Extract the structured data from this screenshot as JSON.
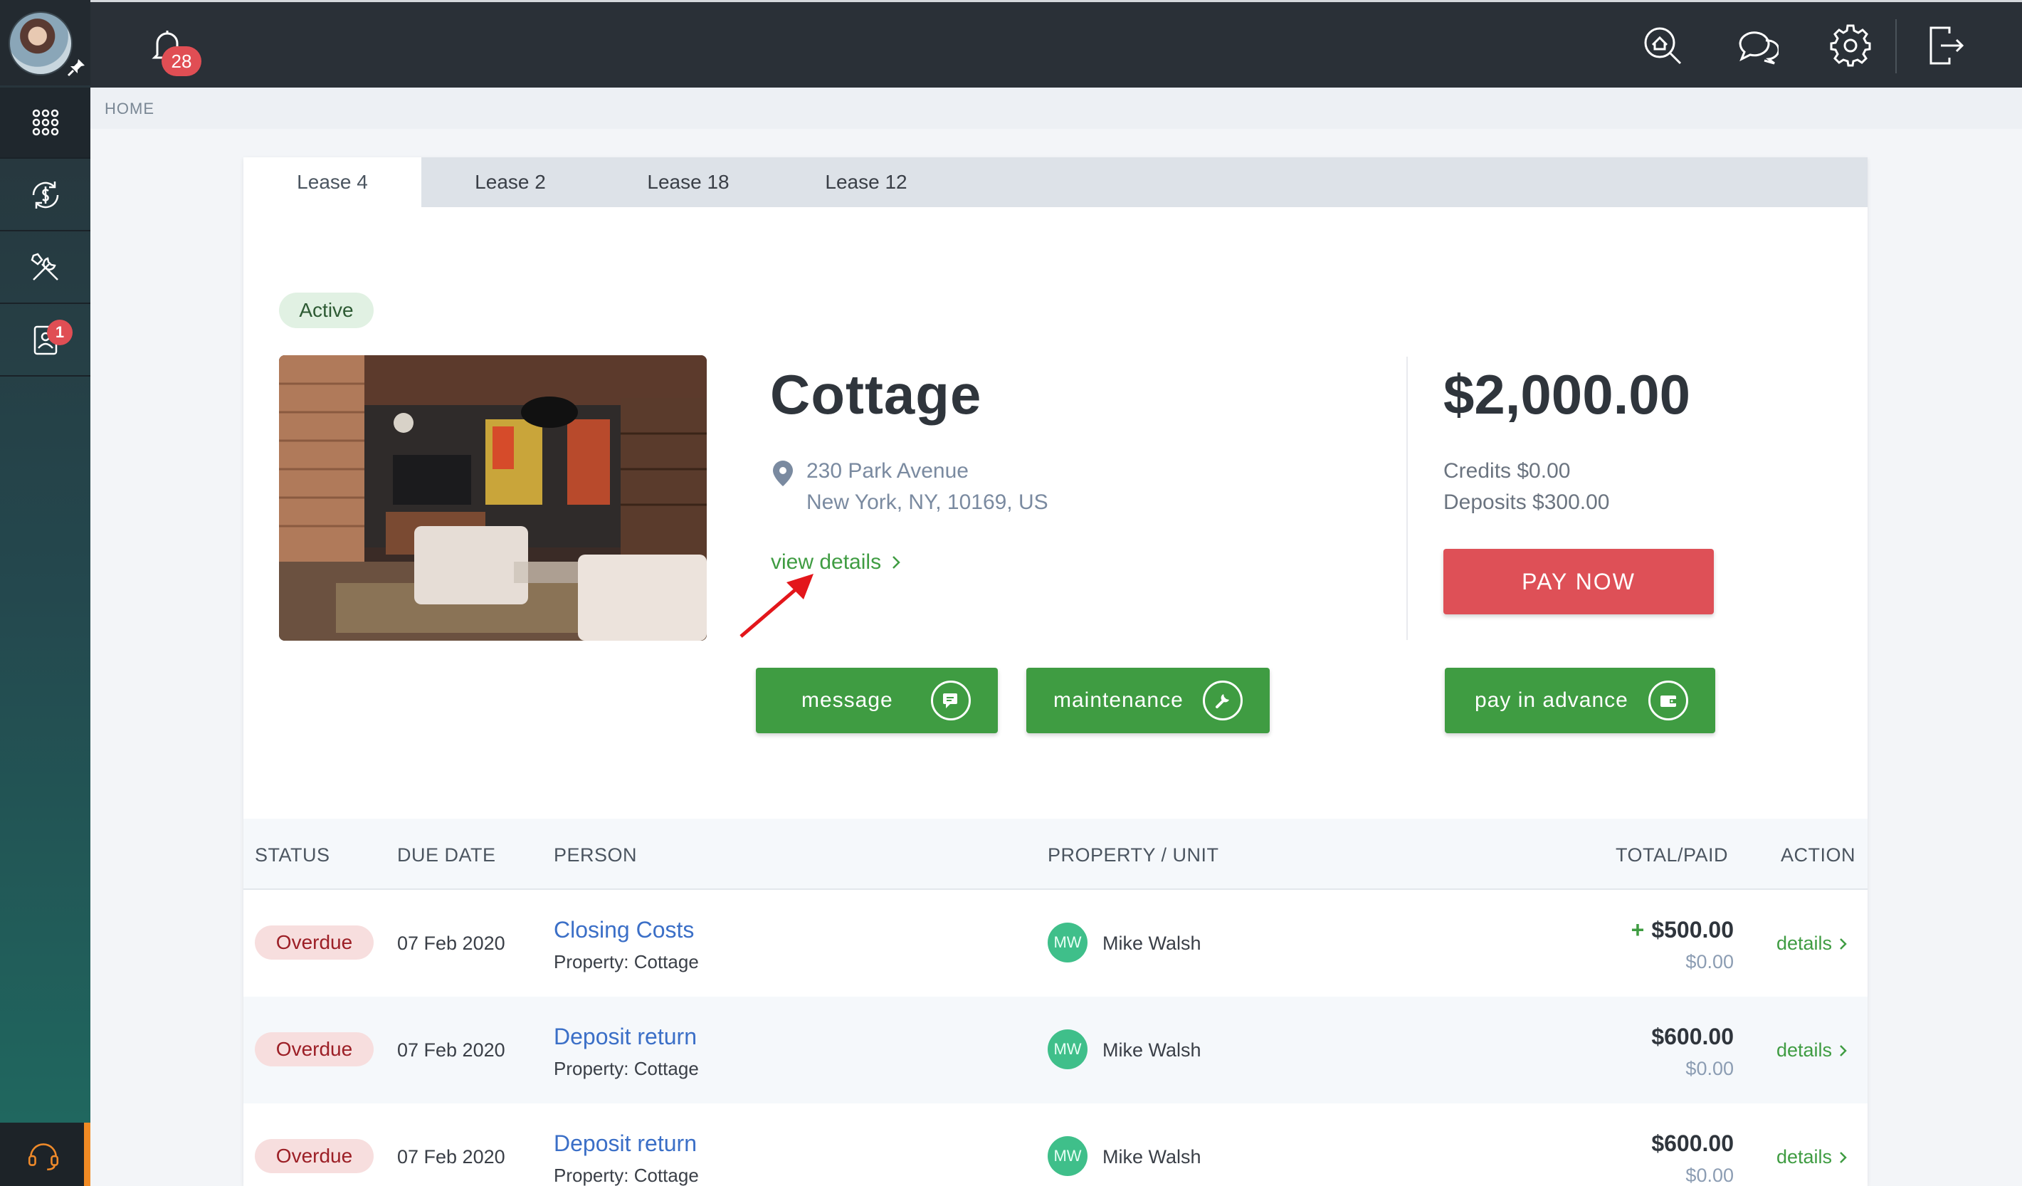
{
  "topbar": {
    "notification_count": "28"
  },
  "sidebar": {
    "documents_badge": "1"
  },
  "breadcrumb": {
    "home": "HOME"
  },
  "tabs": [
    {
      "label": "Lease 4",
      "active": true
    },
    {
      "label": "Lease 2",
      "active": false
    },
    {
      "label": "Lease 18",
      "active": false
    },
    {
      "label": "Lease 12",
      "active": false
    }
  ],
  "lease": {
    "status": "Active",
    "property_name": "Cottage",
    "address_line1": "230 Park Avenue",
    "address_line2": "New York, NY, 10169, US",
    "view_details": "view details",
    "amount": "$2,000.00",
    "credits": "Credits $0.00",
    "deposits": "Deposits $300.00",
    "pay_now": "PAY NOW",
    "buttons": {
      "message": "message",
      "maintenance": "maintenance",
      "pay_in_advance": "pay in advance"
    }
  },
  "table": {
    "headers": {
      "status": "STATUS",
      "due_date": "DUE DATE",
      "person": "PERSON",
      "property_unit": "PROPERTY / UNIT",
      "total_paid": "TOTAL/PAID",
      "action": "ACTION"
    },
    "rows": [
      {
        "status": "Overdue",
        "due_date": "07 Feb 2020",
        "title": "Closing Costs",
        "property": "Property: Cottage",
        "initials": "MW",
        "person": "Mike Walsh",
        "plus": "+",
        "total": "$500.00",
        "paid": "$0.00",
        "action": "details"
      },
      {
        "status": "Overdue",
        "due_date": "07 Feb 2020",
        "title": "Deposit return",
        "property": "Property: Cottage",
        "initials": "MW",
        "person": "Mike Walsh",
        "plus": "",
        "total": "$600.00",
        "paid": "$0.00",
        "action": "details"
      },
      {
        "status": "Overdue",
        "due_date": "07 Feb 2020",
        "title": "Deposit return",
        "property": "Property: Cottage",
        "initials": "MW",
        "person": "Mike Walsh",
        "plus": "",
        "total": "$600.00",
        "paid": "$0.00",
        "action": "details"
      }
    ]
  },
  "colors": {
    "accent_green": "#3f9c42",
    "danger_red": "#de5057",
    "link_blue": "#3b6fc7",
    "topbar": "#2a3037"
  }
}
